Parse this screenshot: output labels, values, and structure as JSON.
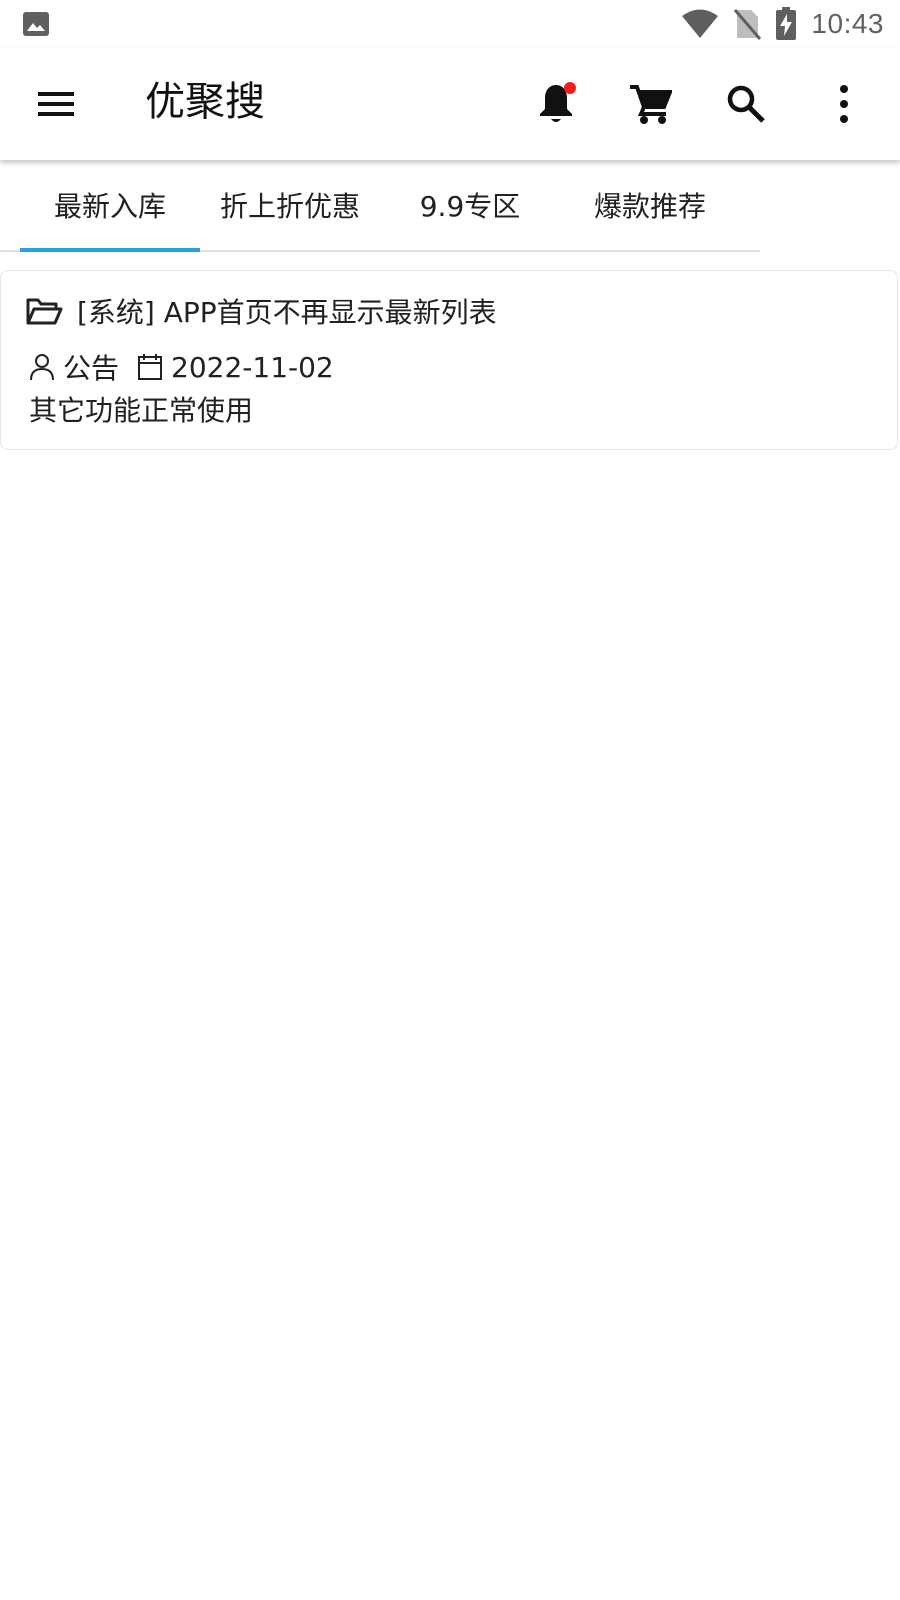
{
  "status_bar": {
    "time": "10:43"
  },
  "app_bar": {
    "title": "优聚搜",
    "actions": [
      "bell-icon",
      "cart-icon",
      "search-icon",
      "more-vert-icon"
    ],
    "notification_dot_color": "#ff1a1a"
  },
  "tabs": [
    {
      "label": "最新入库",
      "active": true
    },
    {
      "label": "折上折优惠",
      "active": false
    },
    {
      "label": "9.9专区",
      "active": false
    },
    {
      "label": "爆款推荐",
      "active": false
    }
  ],
  "accent_color": "#29a3e0",
  "notice": {
    "title": "[系统] APP首页不再显示最新列表",
    "author": "公告",
    "date": "2022-11-02",
    "body": "其它功能正常使用"
  }
}
